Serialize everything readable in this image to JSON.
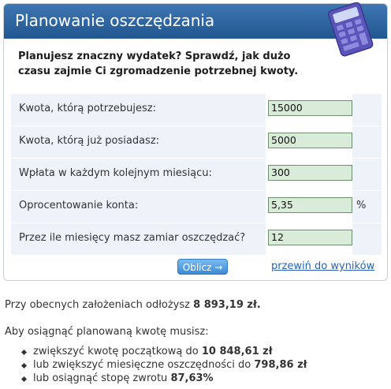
{
  "header": {
    "title": "Planowanie oszczędzania"
  },
  "intro": "Planujesz znaczny wydatek? Sprawdź, jak dużo czasu zajmie Ci zgromadzenie potrzebnej kwoty.",
  "fields": [
    {
      "label": "Kwota, którą potrzebujesz:",
      "value": "15000",
      "unit": ""
    },
    {
      "label": "Kwota, którą już posiadasz:",
      "value": "5000",
      "unit": ""
    },
    {
      "label": "Wpłata w każdym kolejnym miesiącu:",
      "value": "300",
      "unit": ""
    },
    {
      "label": "Oprocentowanie konta:",
      "value": "5,35",
      "unit": "%"
    },
    {
      "label": "Przez ile miesięcy masz zamiar oszczędzać?",
      "value": "12",
      "unit": ""
    }
  ],
  "actions": {
    "calculate": "Oblicz →",
    "jump_results": "przewiń do wyników"
  },
  "result": {
    "text": "Przy obecnych założeniach odłożysz",
    "amount": "8 893,19 zł."
  },
  "need": "Aby osiągnąć planowaną kwotę musisz:",
  "options": [
    {
      "text": "zwiększyć kwotę początkową do",
      "value": "10 848,61 zł"
    },
    {
      "text": "lub zwiększyć miesięczne oszczędności do",
      "value": "798,86 zł"
    },
    {
      "text": "lub osiągnąć stopę zwrotu",
      "value": "87,63%"
    }
  ]
}
